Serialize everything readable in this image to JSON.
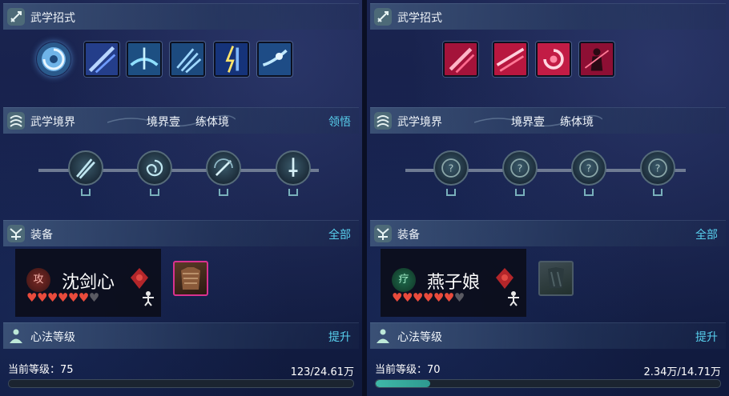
{
  "panels": [
    {
      "skills_header": "武学招式",
      "realm_header": "武学境界",
      "realm_level": "境界壹",
      "realm_name": "练体境",
      "realm_action": "领悟",
      "equip_header": "装备",
      "equip_action": "全部",
      "character": {
        "badge": "攻",
        "name": "沈剑心",
        "hearts_filled": 6,
        "hearts_total": 7
      },
      "xinfa_header": "心法等级",
      "xinfa_action": "提升",
      "level_label": "当前等级：75",
      "level_value": "123/24.61万",
      "progress": 0.0005,
      "skill_theme": "blue",
      "colors": {
        "accent": "#58d0ee",
        "heart": "#e94b3c",
        "bar": "#3fb8a8"
      }
    },
    {
      "skills_header": "武学招式",
      "realm_header": "武学境界",
      "realm_level": "境界壹",
      "realm_name": "练体境",
      "realm_action": "",
      "equip_header": "装备",
      "equip_action": "全部",
      "character": {
        "badge": "疗",
        "name": "燕子娘",
        "hearts_filled": 6,
        "hearts_total": 7
      },
      "xinfa_header": "心法等级",
      "xinfa_action": "提升",
      "level_label": "当前等级：70",
      "level_value": "2.34万/14.71万",
      "progress": 0.159,
      "skill_theme": "red",
      "colors": {
        "accent": "#58d0ee",
        "heart": "#e94b3c",
        "bar": "#3fb8a8"
      }
    }
  ]
}
